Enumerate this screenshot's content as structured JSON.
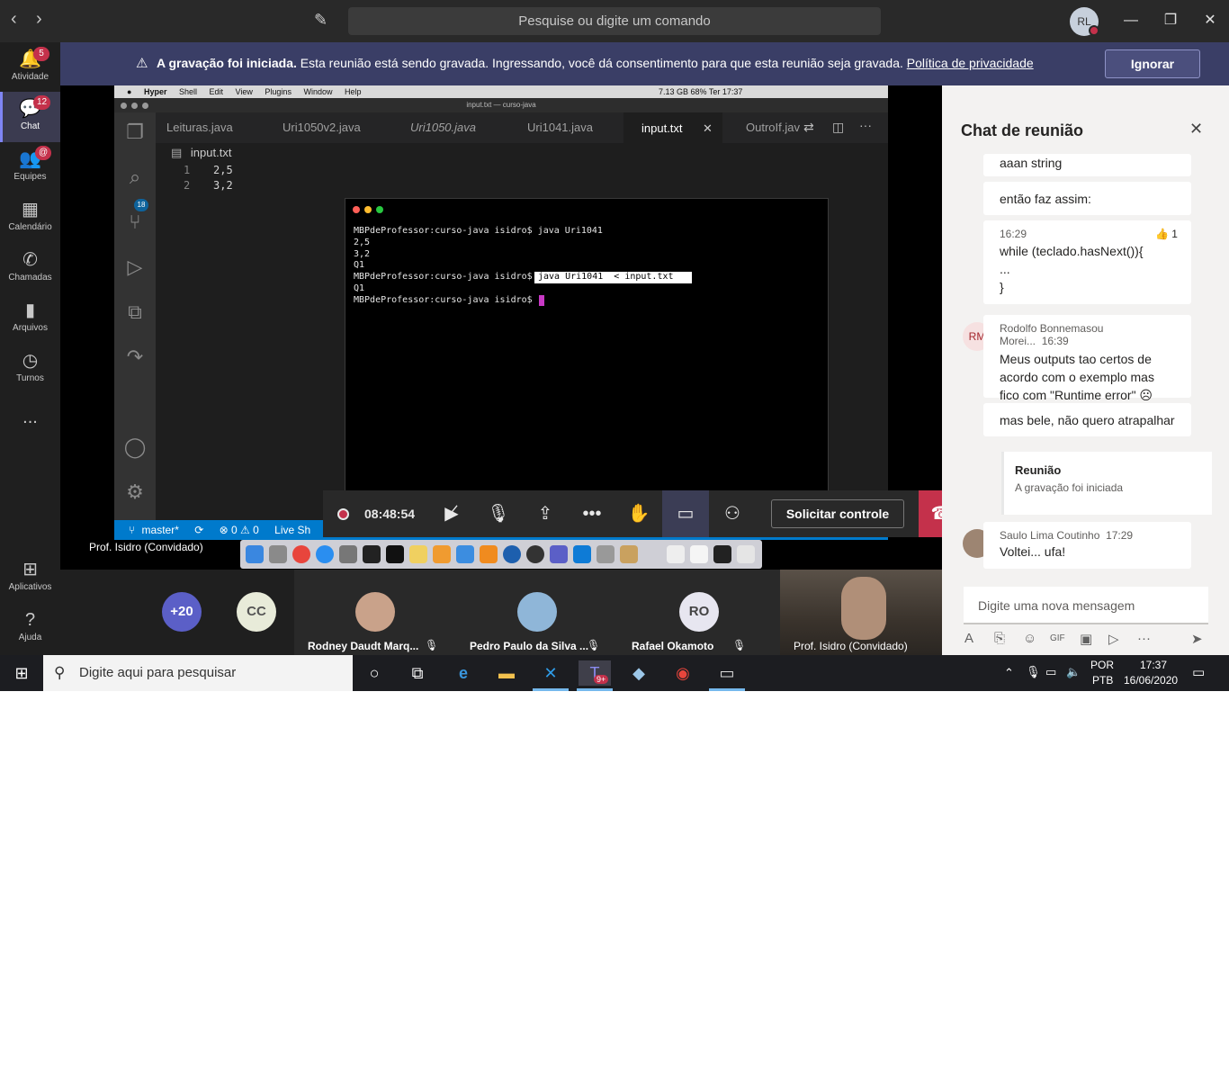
{
  "titlebar": {
    "search_placeholder": "Pesquise ou digite um comando",
    "user_initials": "RL"
  },
  "rail": {
    "items": [
      {
        "label": "Atividade",
        "icon": "bell-icon",
        "badge": "5"
      },
      {
        "label": "Chat",
        "icon": "chat-icon",
        "badge": "12"
      },
      {
        "label": "Equipes",
        "icon": "teams-icon",
        "badge": "@"
      },
      {
        "label": "Calendário",
        "icon": "calendar-icon",
        "badge": ""
      },
      {
        "label": "Chamadas",
        "icon": "phone-icon",
        "badge": ""
      },
      {
        "label": "Arquivos",
        "icon": "file-icon",
        "badge": ""
      },
      {
        "label": "Turnos",
        "icon": "clock-icon",
        "badge": ""
      },
      {
        "label": "...",
        "icon": "more-icon",
        "badge": ""
      },
      {
        "label": "Aplicativos",
        "icon": "apps-icon",
        "badge": ""
      },
      {
        "label": "Ajuda",
        "icon": "help-icon",
        "badge": ""
      }
    ]
  },
  "banner": {
    "bold": "A gravação foi iniciada.",
    "text": " Esta reunião está sendo gravada. Ingressando, você dá consentimento para que esta reunião seja gravada. ",
    "link": "Política de privacidade",
    "button": "Ignorar"
  },
  "shared_screen": {
    "menubar": [
      "Hyper",
      "Shell",
      "Edit",
      "View",
      "Plugins",
      "Window",
      "Help"
    ],
    "menubar_right": "7.13 GB   68%   Ter 17:37",
    "vscode_title": "input.txt — curso-java",
    "tabs": [
      "Leituras.java",
      "Uri1050v2.java",
      "Uri1050.java",
      "Uri1041.java",
      "input.txt",
      "OutroIf.jav"
    ],
    "active_tab": "input.txt",
    "breadcrumb": "input.txt",
    "code_lines": [
      {
        "num": "1",
        "text": "2,5"
      },
      {
        "num": "2",
        "text": "3,2"
      }
    ],
    "scm_badge": "18",
    "status": {
      "branch": "master*",
      "problems": "⊗ 0 ⚠ 0",
      "liveshare": "Live Sh"
    },
    "terminal": {
      "lines": [
        "MBPdeProfessor:curso-java isidro$ java Uri1041",
        "2,5",
        "3,2",
        "Q1",
        "MBPdeProfessor:curso-java isidro$",
        "Q1",
        "MBPdeProfessor:curso-java isidro$"
      ],
      "selected": "java Uri1041  < input.txt"
    }
  },
  "controls": {
    "timer": "08:48:54",
    "request_control": "Solicitar controle"
  },
  "presenter_label": "Prof. Isidro (Convidado)",
  "gallery": {
    "overflow": "+20",
    "cc": "CC",
    "participants": [
      {
        "name": "Rodney Daudt Marq..."
      },
      {
        "name": "Pedro Paulo da Silva ..."
      },
      {
        "name": "Rafael Okamoto",
        "initials": "RO"
      },
      {
        "name": "Prof. Isidro (Convidado)"
      }
    ]
  },
  "chat": {
    "title": "Chat de reunião",
    "messages": [
      {
        "text": "aaan string"
      },
      {
        "text": "então faz assim:"
      },
      {
        "time": "16:29",
        "reaction": "👍 1",
        "lines": [
          "while (teclado.hasNext()){",
          "...",
          "}"
        ]
      },
      {
        "author": "Rodolfo Bonnemasou Morei...",
        "time": "16:39",
        "initials": "RM",
        "text": "Meus outputs tao certos de acordo com o exemplo mas fico com \"Runtime error\" ☹"
      },
      {
        "text": "mas bele, não quero atrapalhar"
      },
      {
        "event_title": "Reunião",
        "event_text": "A gravação foi iniciada"
      },
      {
        "author": "Saulo Lima Coutinho",
        "time": "17:29",
        "text": "Voltei... ufa!"
      }
    ],
    "compose_placeholder": "Digite uma nova mensagem"
  },
  "taskbar": {
    "search_placeholder": "Digite aqui para pesquisar",
    "teams_badge": "9+",
    "lang": "POR",
    "layout": "PTB",
    "time": "17:37",
    "date": "16/06/2020"
  }
}
